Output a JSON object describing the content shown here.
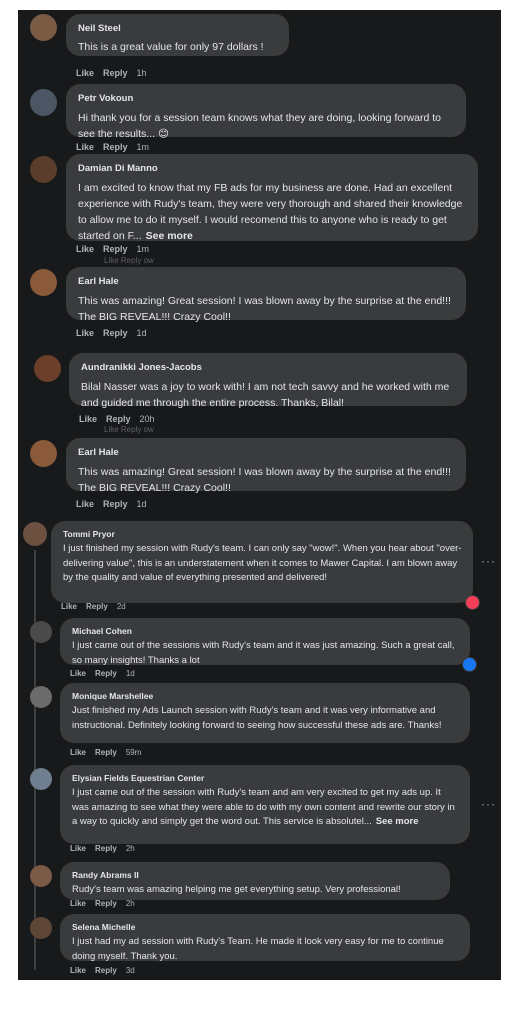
{
  "colors": {
    "feed_background": "#18191a",
    "bubble": "#3a3b3c",
    "text": "#e4e6eb",
    "secondary_text": "#b0b3b8",
    "love_reaction": "#f33e58",
    "like_reaction": "#1877f2"
  },
  "actions": {
    "like": "Like",
    "reply": "Reply",
    "see_more": "See more",
    "more_icon": "···"
  },
  "ghost_text": "Like  Reply  ow",
  "comments": [
    {
      "author": "Neil Steel",
      "text": "This is a great value for only 97 dollars !",
      "time": "1h"
    },
    {
      "author": "Petr Vokoun",
      "text": "Hi thank you for a session team knows what they are doing, looking forward to see the results... 😊",
      "time": "1m"
    },
    {
      "author": "Damian Di Manno",
      "text": "I am excited to know that my FB ads for my business are done. Had an excellent experience with Rudy's team, they were very thorough and shared their knowledge to allow me to do it myself. I would recomend this to anyone who is ready to get started on F...",
      "time": "1m"
    },
    {
      "author": "Earl Hale",
      "text": "This was amazing! Great session! I was blown away by the surprise at the end!!! The BIG REVEAL!!! Crazy Cool!!",
      "time": "1d"
    },
    {
      "author": "Aundranikki Jones-Jacobs",
      "text": "Bilal Nasser was a joy to work with! I am not tech savvy and he worked with me and guided me through the entire process. Thanks, Bilal!",
      "time": "20h"
    },
    {
      "author": "Earl Hale",
      "text": "This was amazing! Great session! I was blown away by the surprise at the end!!! The BIG REVEAL!!! Crazy Cool!!",
      "time": "1d"
    },
    {
      "author": "Tommi Pryor",
      "text": "I just finished my session with Rudy's team. I can only say \"wow!\". When you hear about \"over-delivering value\", this is an understatement when it comes to Mawer Capital. I am blown away by the quality and value of everything presented and delivered!",
      "time": "2d",
      "reaction": "love-reaction-icon"
    },
    {
      "author": "Michael Cohen",
      "text": "I just came out of the sessions with Rudy's team and it was just amazing. Such a great call, so many insights! Thanks a lot",
      "time": "1d",
      "reaction": "like-reaction-icon"
    },
    {
      "author": "Monique Marshellee",
      "text": "Just finished my Ads Launch session with Rudy's team and it was very informative and instructional. Definitely looking forward to seeing how successful these ads are. Thanks!",
      "time": "59m"
    },
    {
      "author": "Elysian Fields Equestrian Center",
      "text": "I just came out of the session with Rudy's team and am very excited to get my ads up. It was amazing to see what they were able to do with my own content and rewrite our story in a way to quickly and simply get the word out. This service is absolutel...",
      "time": "2h"
    },
    {
      "author": "Randy Abrams II",
      "text": "Rudy's team was amazing helping me get everything setup. Very professional!",
      "time": "2h"
    },
    {
      "author": "Selena Michelle",
      "text": "I just had my ad session with Rudy's Team. He made it look very easy for me to continue doing myself. Thank you.",
      "time": "3d"
    }
  ]
}
